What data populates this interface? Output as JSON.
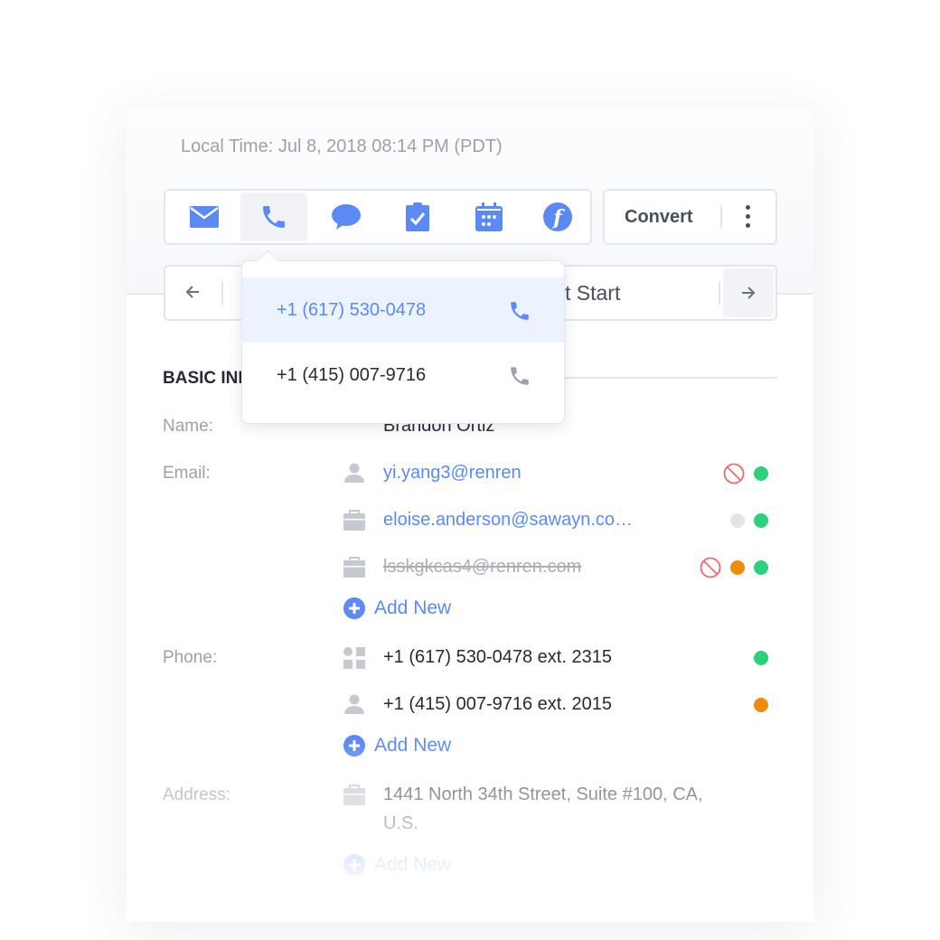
{
  "header": {
    "local_time": "Local Time: Jul 8, 2018 08:14 PM (PDT)"
  },
  "toolbar": {
    "icons": [
      "envelope-icon",
      "phone-icon",
      "chat-bubble-icon",
      "clipboard-check-icon",
      "calendar-icon",
      "f-circle-icon"
    ],
    "active": "phone",
    "convert_label": "Convert",
    "accent": "#5b8af5"
  },
  "stage_bar": {
    "stage_text": "t Start"
  },
  "phone_dropdown": {
    "items": [
      {
        "number": "+1 (617) 530-0478",
        "selected": true
      },
      {
        "number": "+1 (415) 007-9716",
        "selected": false
      }
    ]
  },
  "basic_info": {
    "title": "BASIC INFO",
    "name_label": "Name:",
    "name": "Brandon Ortiz",
    "email_label": "Email:",
    "emails": [
      {
        "value": "yi.yang3@renren",
        "type": "person",
        "status": [
          "blocked",
          "green"
        ]
      },
      {
        "value": "eloise.anderson@sawayn.co…",
        "type": "work",
        "status": [
          "grey",
          "green"
        ]
      },
      {
        "value": "lsskgkcas4@renren.com",
        "type": "work",
        "struck": true,
        "status": [
          "blocked",
          "orange",
          "green"
        ]
      }
    ],
    "add_new": "Add New",
    "phone_label": "Phone:",
    "phones": [
      {
        "value": "+1 (617) 530-0478  ext. 2315",
        "type": "office",
        "status": "green"
      },
      {
        "value": "+1 (415) 007-9716  ext. 2015",
        "type": "person",
        "status": "orange"
      }
    ],
    "address_label": "Address:",
    "address_line1": "1441 North 34th Street, Suite #100, CA,",
    "address_line2": "U.S."
  },
  "colors": {
    "green": "#2dd17c",
    "orange": "#f08a0c",
    "grey": "#e2e4e8",
    "blocked": "#f06a6a"
  }
}
